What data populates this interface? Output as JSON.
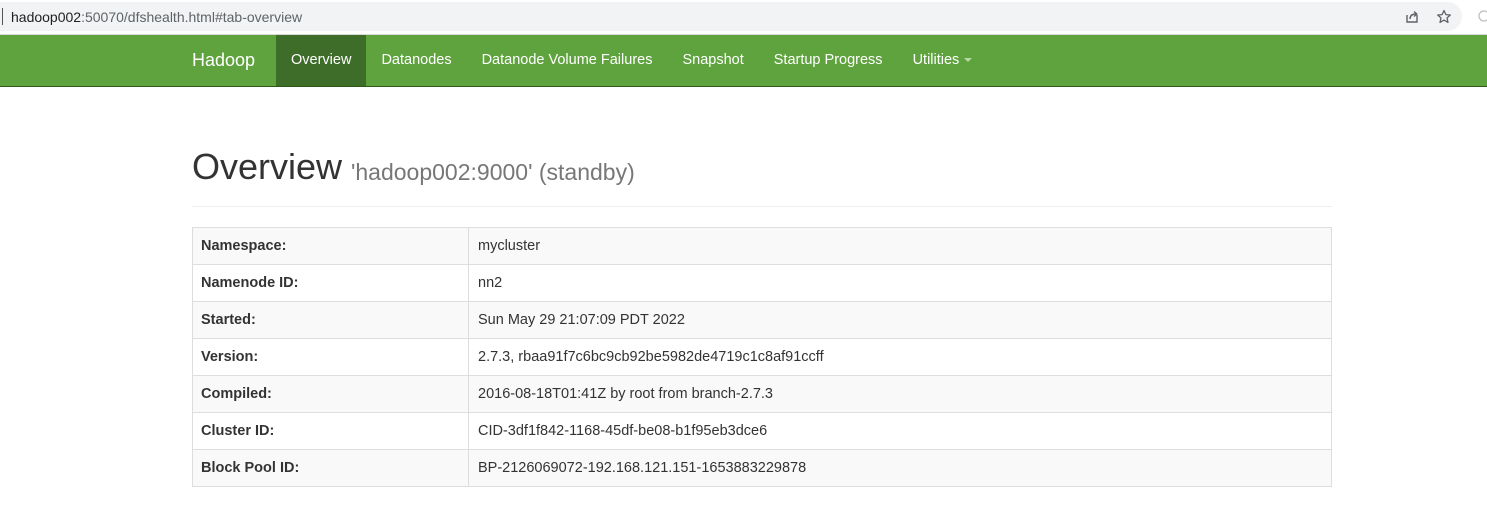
{
  "browser": {
    "url_host": "hadoop002",
    "url_rest": ":50070/dfshealth.html#tab-overview"
  },
  "navbar": {
    "brand": "Hadoop",
    "items": [
      {
        "label": "Overview",
        "active": true
      },
      {
        "label": "Datanodes"
      },
      {
        "label": "Datanode Volume Failures"
      },
      {
        "label": "Snapshot"
      },
      {
        "label": "Startup Progress"
      },
      {
        "label": "Utilities",
        "dropdown": true
      }
    ]
  },
  "header": {
    "title": "Overview",
    "subtitle": "'hadoop002:9000' (standby)"
  },
  "overview": {
    "rows": [
      {
        "key": "Namespace:",
        "value": "mycluster"
      },
      {
        "key": "Namenode ID:",
        "value": "nn2"
      },
      {
        "key": "Started:",
        "value": "Sun May 29 21:07:09 PDT 2022"
      },
      {
        "key": "Version:",
        "value": "2.7.3, rbaa91f7c6bc9cb92be5982de4719c1c8af91ccff"
      },
      {
        "key": "Compiled:",
        "value": "2016-08-18T01:41Z by root from branch-2.7.3"
      },
      {
        "key": "Cluster ID:",
        "value": "CID-3df1f842-1168-45df-be08-b1f95eb3dce6"
      },
      {
        "key": "Block Pool ID:",
        "value": "BP-2126069072-192.168.121.151-1653883229878"
      }
    ]
  },
  "colors": {
    "navbar": "#5fa33e",
    "navbar_active": "#3e6d2a"
  }
}
